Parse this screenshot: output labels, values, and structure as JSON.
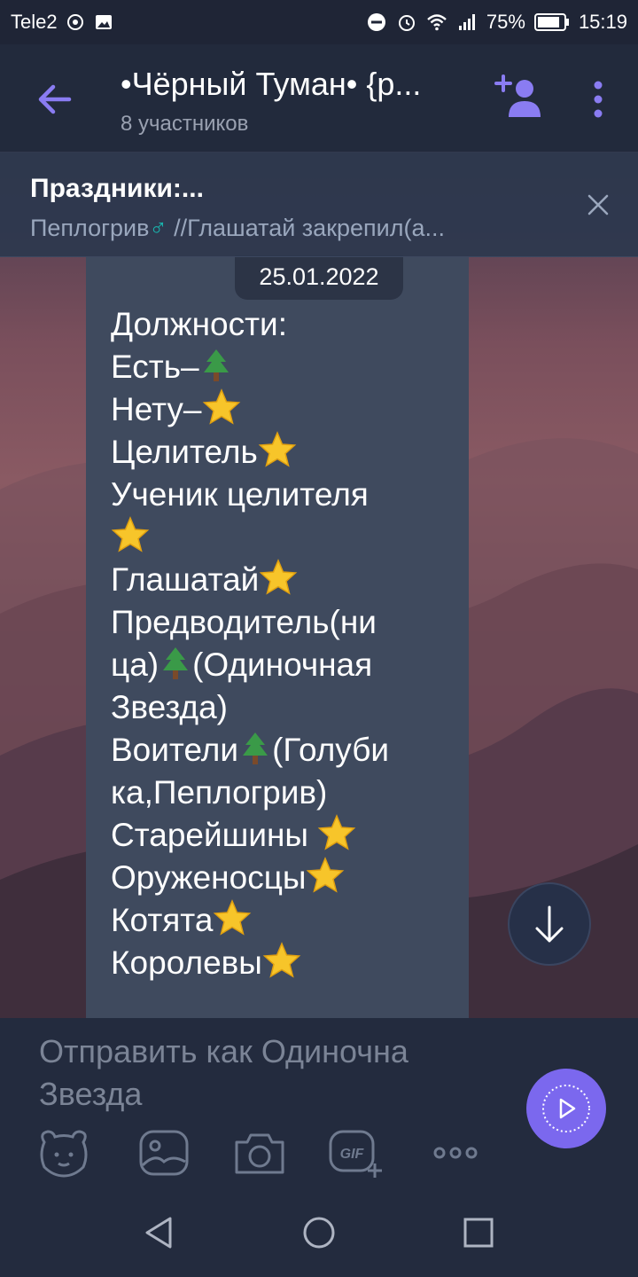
{
  "status_bar": {
    "carrier": "Tele2",
    "battery": "75%",
    "time": "15:19"
  },
  "header": {
    "title": "•Чёрный Туман• {р...",
    "subtitle": "8 участников"
  },
  "pinned": {
    "title": "Праздники:...",
    "text_before": "Пеплогрив",
    "male_symbol": "♂",
    "text_after": " //Глашатай  закрепил(а..."
  },
  "message": {
    "date": "25.01.2022",
    "lines": [
      {
        "text": "Должности:",
        "emoji": ""
      },
      {
        "text": "Есть–",
        "emoji": "tree"
      },
      {
        "text": "Нету–",
        "emoji": "star"
      },
      {
        "text": "Целитель",
        "emoji": "star"
      },
      {
        "text": "Ученик целителя",
        "emoji": ""
      },
      {
        "text": "",
        "emoji": "star"
      },
      {
        "text": "Глашатай",
        "emoji": "star"
      },
      {
        "text": "Предводитель(ни",
        "emoji": ""
      },
      {
        "text": "ца)",
        "emoji": "tree",
        "after": "(Одиночная"
      },
      {
        "text": "Звезда)",
        "emoji": ""
      },
      {
        "text": "Воители",
        "emoji": "tree",
        "after": "(Голуби"
      },
      {
        "text": "ка,Пеплогрив)",
        "emoji": ""
      },
      {
        "text": "Старейшины ",
        "emoji": "star"
      },
      {
        "text": "Оруженосцы",
        "emoji": "star"
      },
      {
        "text": "Котята",
        "emoji": "star"
      },
      {
        "text": "Королевы",
        "emoji": "star"
      }
    ]
  },
  "composer": {
    "placeholder": "Отправить как Одиночна Звезда"
  },
  "colors": {
    "accent": "#7b68ee",
    "header_bg": "#222a3c",
    "bubble_bg": "#3f4a5e"
  }
}
